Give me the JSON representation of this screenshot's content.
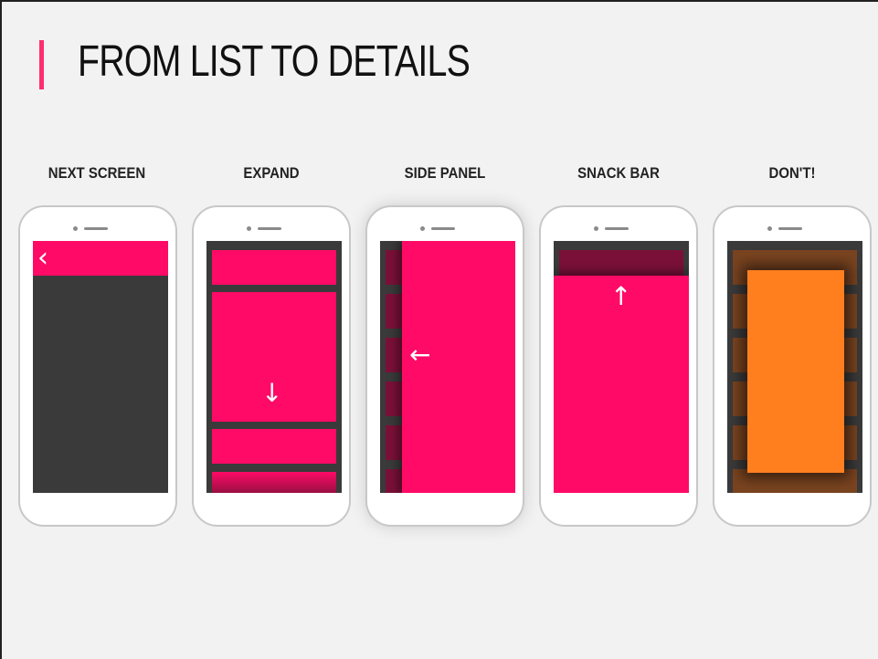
{
  "title": "FROM LIST TO DETAILS",
  "colors": {
    "accent": "#ff0a66",
    "dark": "#3a3a3a",
    "orange": "#ff7f1f"
  },
  "panels": [
    {
      "label": "NEXT SCREEN",
      "icon": "back-chevron-icon",
      "glyph": "‹"
    },
    {
      "label": "EXPAND",
      "icon": "arrow-down-icon",
      "glyph": "↓"
    },
    {
      "label": "SIDE PANEL",
      "icon": "arrow-left-icon",
      "glyph": "←"
    },
    {
      "label": "SNACK BAR",
      "icon": "arrow-up-icon",
      "glyph": "↑"
    },
    {
      "label": "DON'T!"
    }
  ]
}
